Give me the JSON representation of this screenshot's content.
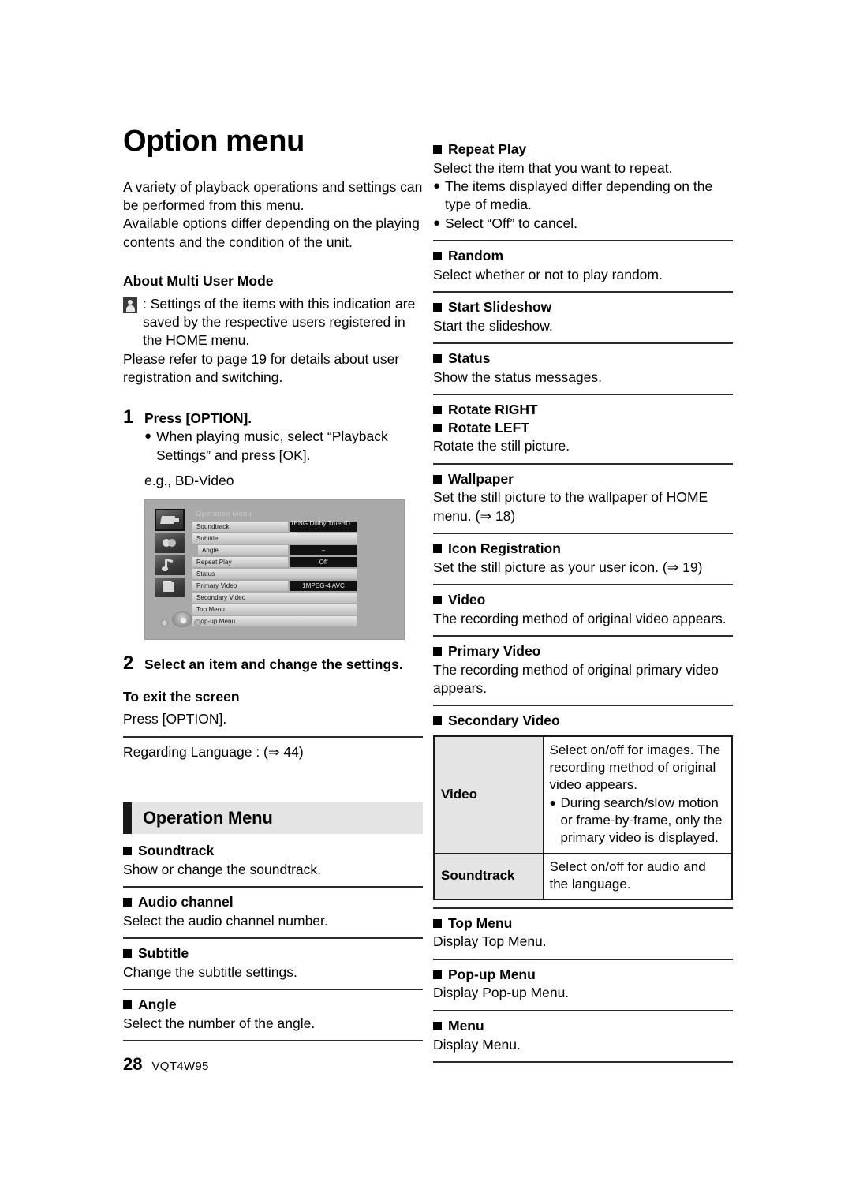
{
  "page": {
    "title": "Option menu",
    "number": "28",
    "doc_code": "VQT4W95"
  },
  "intro": {
    "para1": "A variety of playback operations and settings can be performed from this menu.",
    "para2": "Available options differ depending on the playing contents and the condition of the unit."
  },
  "multi_user": {
    "heading": "About Multi User Mode",
    "icon_name": "multi-user-icon",
    "text1": ": Settings of the items with this indication are saved by the respective users registered in the HOME menu.",
    "text2": "Please refer to page 19 for details about user registration and switching."
  },
  "steps": [
    {
      "num": "1",
      "text": "Press [OPTION].",
      "bullets": [
        "When playing music, select “Playback Settings” and press [OK]."
      ],
      "example_label": "e.g., BD-Video"
    },
    {
      "num": "2",
      "text": "Select an item and change the settings."
    }
  ],
  "exit": {
    "heading": "To exit the screen",
    "text": "Press [OPTION]."
  },
  "language_note": "Regarding Language : (⇒ 44)",
  "tv_screen": {
    "title": "Operation Menu",
    "side_icons": [
      "video-icon",
      "subtitle-icon",
      "music-icon",
      "picture-icon"
    ],
    "rows": [
      {
        "name": "Soundtrack",
        "value": "1ENG Dolby TrueHD  ...",
        "indent": false
      },
      {
        "name": "Subtitle",
        "value": "",
        "indent": false
      },
      {
        "name": "Angle",
        "value": "–",
        "indent": true
      },
      {
        "name": "Repeat Play",
        "value": "Off",
        "indent": false
      },
      {
        "name": "Status",
        "value": "",
        "indent": false
      },
      {
        "name": "Primary Video",
        "value": "1MPEG-4 AVC",
        "indent": false
      },
      {
        "name": "Secondary Video",
        "value": "",
        "indent": false
      },
      {
        "name": "Top Menu",
        "value": "",
        "indent": false
      },
      {
        "name": "Pop-up Menu",
        "value": "",
        "indent": false
      }
    ],
    "dpad_icon": "dpad-icon"
  },
  "operation_menu": {
    "band_title": "Operation Menu",
    "entries": [
      {
        "title": "Soundtrack",
        "desc": "Show or change the soundtrack."
      },
      {
        "title": "Audio channel",
        "desc": "Select the audio channel number."
      },
      {
        "title": "Subtitle",
        "desc": "Change the subtitle settings."
      },
      {
        "title": "Angle",
        "desc": "Select the number of the angle."
      }
    ]
  },
  "right_entries": [
    {
      "title": "Repeat Play",
      "desc": "Select the item that you want to repeat.",
      "bullets": [
        "The items displayed differ depending on the type of media.",
        "Select “Off” to cancel."
      ]
    },
    {
      "title": "Random",
      "desc": "Select whether or not to play random."
    },
    {
      "title": "Start Slideshow",
      "desc": "Start the slideshow."
    },
    {
      "title": "Status",
      "desc": "Show the status messages."
    },
    {
      "title": "Rotate RIGHT",
      "title2": "Rotate LEFT",
      "desc": "Rotate the still picture."
    },
    {
      "title": "Wallpaper",
      "desc": "Set the still picture to the wallpaper of HOME menu. (⇒ 18)"
    },
    {
      "title": "Icon Registration",
      "desc": "Set the still picture as your user icon. (⇒ 19)"
    },
    {
      "title": "Video",
      "desc": "The recording method of original video appears."
    },
    {
      "title": "Primary Video",
      "desc": "The recording method of original primary video appears."
    }
  ],
  "secondary_video": {
    "title": "Secondary Video",
    "table": {
      "rows": [
        {
          "label": "Video",
          "text": "Select on/off for images. The recording method of original video appears.",
          "bullets": [
            "During search/slow motion or frame-by-frame, only the primary video is displayed."
          ]
        },
        {
          "label": "Soundtrack",
          "text": "Select on/off for audio and the language.",
          "bullets": []
        }
      ]
    }
  },
  "right_entries_tail": [
    {
      "title": "Top Menu",
      "desc": "Display Top Menu."
    },
    {
      "title": "Pop-up Menu",
      "desc": "Display Pop-up Menu."
    },
    {
      "title": "Menu",
      "desc": "Display Menu."
    }
  ]
}
